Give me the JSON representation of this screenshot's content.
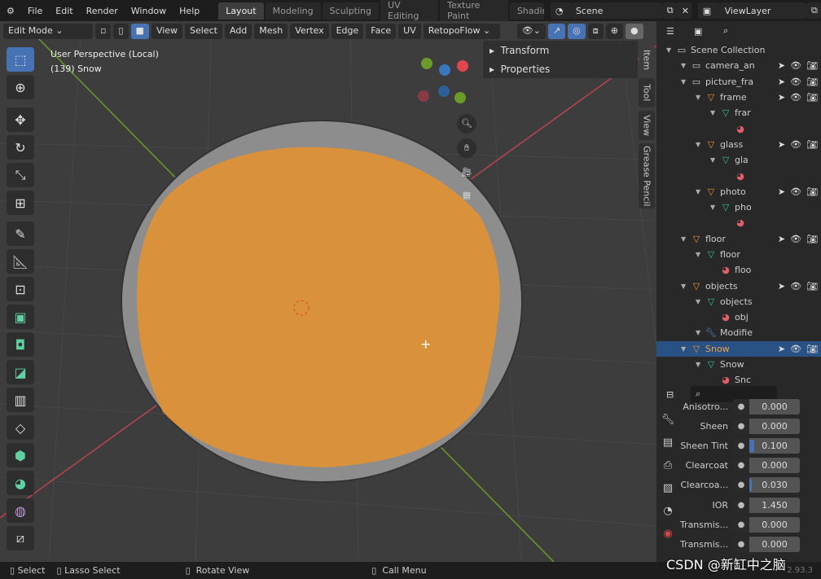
{
  "menu": [
    "File",
    "Edit",
    "Render",
    "Window",
    "Help"
  ],
  "workspaces": [
    "Layout",
    "Modeling",
    "Sculpting",
    "UV Editing",
    "Texture Paint",
    "Shading"
  ],
  "scene": "Scene",
  "view_layer": "ViewLayer",
  "header": {
    "mode": "Edit Mode",
    "items": [
      "View",
      "Select",
      "Add",
      "Mesh",
      "Vertex",
      "Edge",
      "Face",
      "UV"
    ],
    "addon": "RetopoFlow"
  },
  "viewport": {
    "perspective": "User Perspective (Local)",
    "object": "(139) Snow",
    "panels": [
      "Transform",
      "Properties"
    ],
    "tabs": [
      "Item",
      "Tool",
      "View",
      "Grease Pencil"
    ]
  },
  "outliner": {
    "rows": [
      {
        "name": "Scene Collection",
        "indent": 0,
        "kind": "collection"
      },
      {
        "name": "camera_an",
        "indent": 1,
        "kind": "collection"
      },
      {
        "name": "picture_fra",
        "indent": 1,
        "kind": "collection"
      },
      {
        "name": "frame",
        "indent": 2,
        "kind": "object"
      },
      {
        "name": "frar",
        "indent": 3,
        "kind": "mesh"
      },
      {
        "name": "",
        "indent": 4,
        "kind": "material"
      },
      {
        "name": "glass",
        "indent": 2,
        "kind": "object"
      },
      {
        "name": "gla",
        "indent": 3,
        "kind": "mesh"
      },
      {
        "name": "",
        "indent": 4,
        "kind": "material"
      },
      {
        "name": "photo",
        "indent": 2,
        "kind": "object"
      },
      {
        "name": "pho",
        "indent": 3,
        "kind": "mesh"
      },
      {
        "name": "",
        "indent": 4,
        "kind": "material"
      },
      {
        "name": "floor",
        "indent": 1,
        "kind": "object"
      },
      {
        "name": "floor",
        "indent": 2,
        "kind": "mesh"
      },
      {
        "name": "floo",
        "indent": 3,
        "kind": "material"
      },
      {
        "name": "objects",
        "indent": 1,
        "kind": "object"
      },
      {
        "name": "objects",
        "indent": 2,
        "kind": "mesh"
      },
      {
        "name": "obj",
        "indent": 3,
        "kind": "material"
      },
      {
        "name": "Modifie",
        "indent": 2,
        "kind": "modifier"
      },
      {
        "name": "Snow",
        "indent": 1,
        "kind": "object",
        "selected": true
      },
      {
        "name": "Snow",
        "indent": 2,
        "kind": "mesh"
      },
      {
        "name": "Snc",
        "indent": 3,
        "kind": "material"
      }
    ]
  },
  "properties": [
    {
      "label": "Anisotro...",
      "value": "0.000"
    },
    {
      "label": "Sheen",
      "value": "0.000"
    },
    {
      "label": "Sheen Tint",
      "value": "0.100",
      "fill": 0.1
    },
    {
      "label": "Clearcoat",
      "value": "0.000"
    },
    {
      "label": "Clearcoa...",
      "value": "0.030",
      "fill": 0.03
    },
    {
      "label": "IOR",
      "value": "1.450"
    },
    {
      "label": "Transmis...",
      "value": "0.000"
    },
    {
      "label": "Transmis...",
      "value": "0.000"
    }
  ],
  "status": {
    "select": "Select",
    "lasso": "Lasso Select",
    "rotate": "Rotate View",
    "menu": "Call Menu",
    "version": "2.93.3"
  },
  "watermark": "CSDN @新缸中之脑",
  "colors": {
    "accent": "#4772b3",
    "mesh_select": "#e8922e",
    "x_axis": "#c8464f",
    "y_axis": "#6a9a2a"
  }
}
